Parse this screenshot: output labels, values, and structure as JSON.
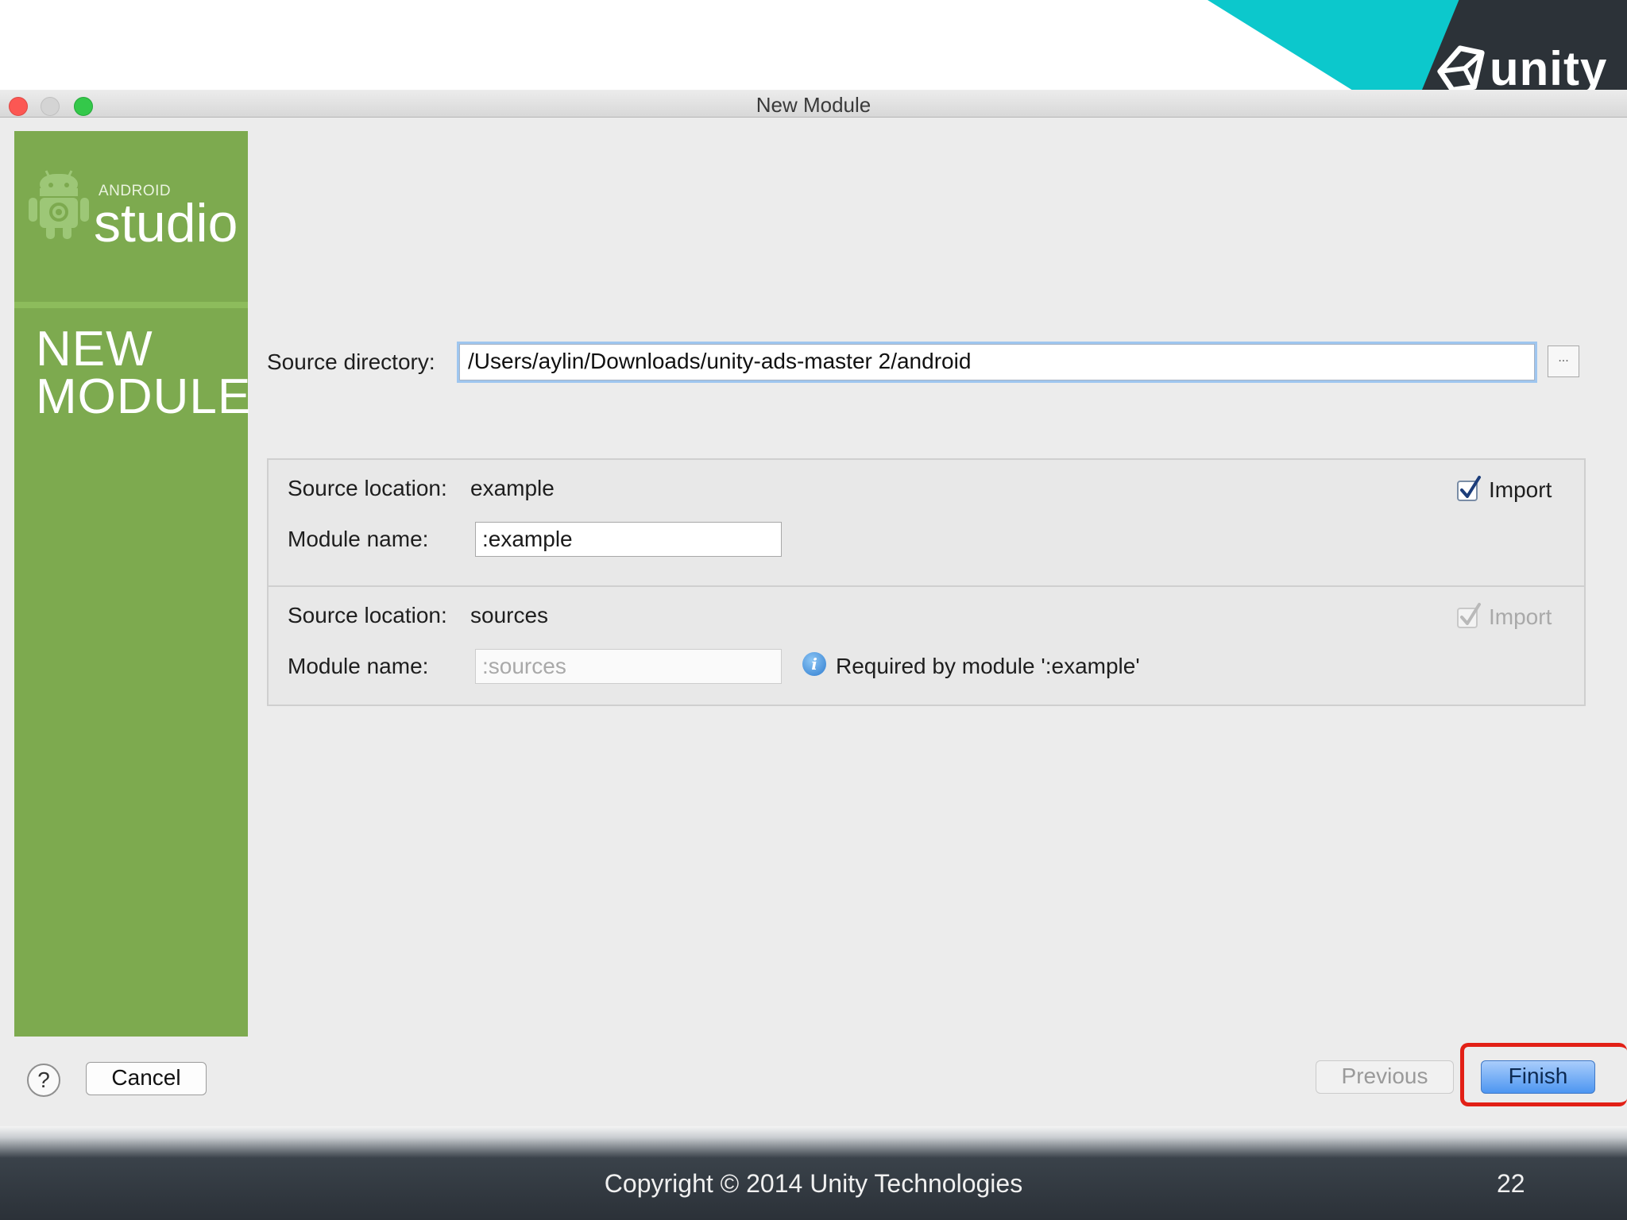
{
  "slide": {
    "logo_text": "unity",
    "copyright": "Copyright © 2014 Unity Technologies",
    "page_number": "22"
  },
  "window": {
    "title": "New Module"
  },
  "sidebar": {
    "brand_small": "ANDROID",
    "brand_big": "studio",
    "heading_line1": "NEW",
    "heading_line2": "MODULE",
    "color": "#7daa4f"
  },
  "source_directory": {
    "label": "Source directory:",
    "value": "/Users/aylin/Downloads/unity-ads-master 2/android",
    "browse_label": "..."
  },
  "modules": [
    {
      "location_label": "Source location:",
      "location_value": "example",
      "name_label": "Module name:",
      "name_value": ":example",
      "import_label": "Import",
      "import_checked": true,
      "import_enabled": true
    },
    {
      "location_label": "Source location:",
      "location_value": "sources",
      "name_label": "Module name:",
      "name_value": ":sources",
      "import_label": "Import",
      "import_checked": true,
      "import_enabled": false,
      "info_message": "Required by module ':example'"
    }
  ],
  "buttons": {
    "help": "?",
    "cancel": "Cancel",
    "previous": "Previous",
    "finish": "Finish"
  },
  "icons": {
    "window_close": "close-icon",
    "window_minimize": "minimize-icon",
    "window_zoom": "zoom-icon",
    "android": "android-robot-icon",
    "unity": "unity-cube-icon",
    "checkbox": "checkmark-icon",
    "info": "info-icon"
  },
  "colors": {
    "teal": "#0cc8cc",
    "finish_highlight": "#e22016",
    "finish_button": "#4d96f1"
  }
}
